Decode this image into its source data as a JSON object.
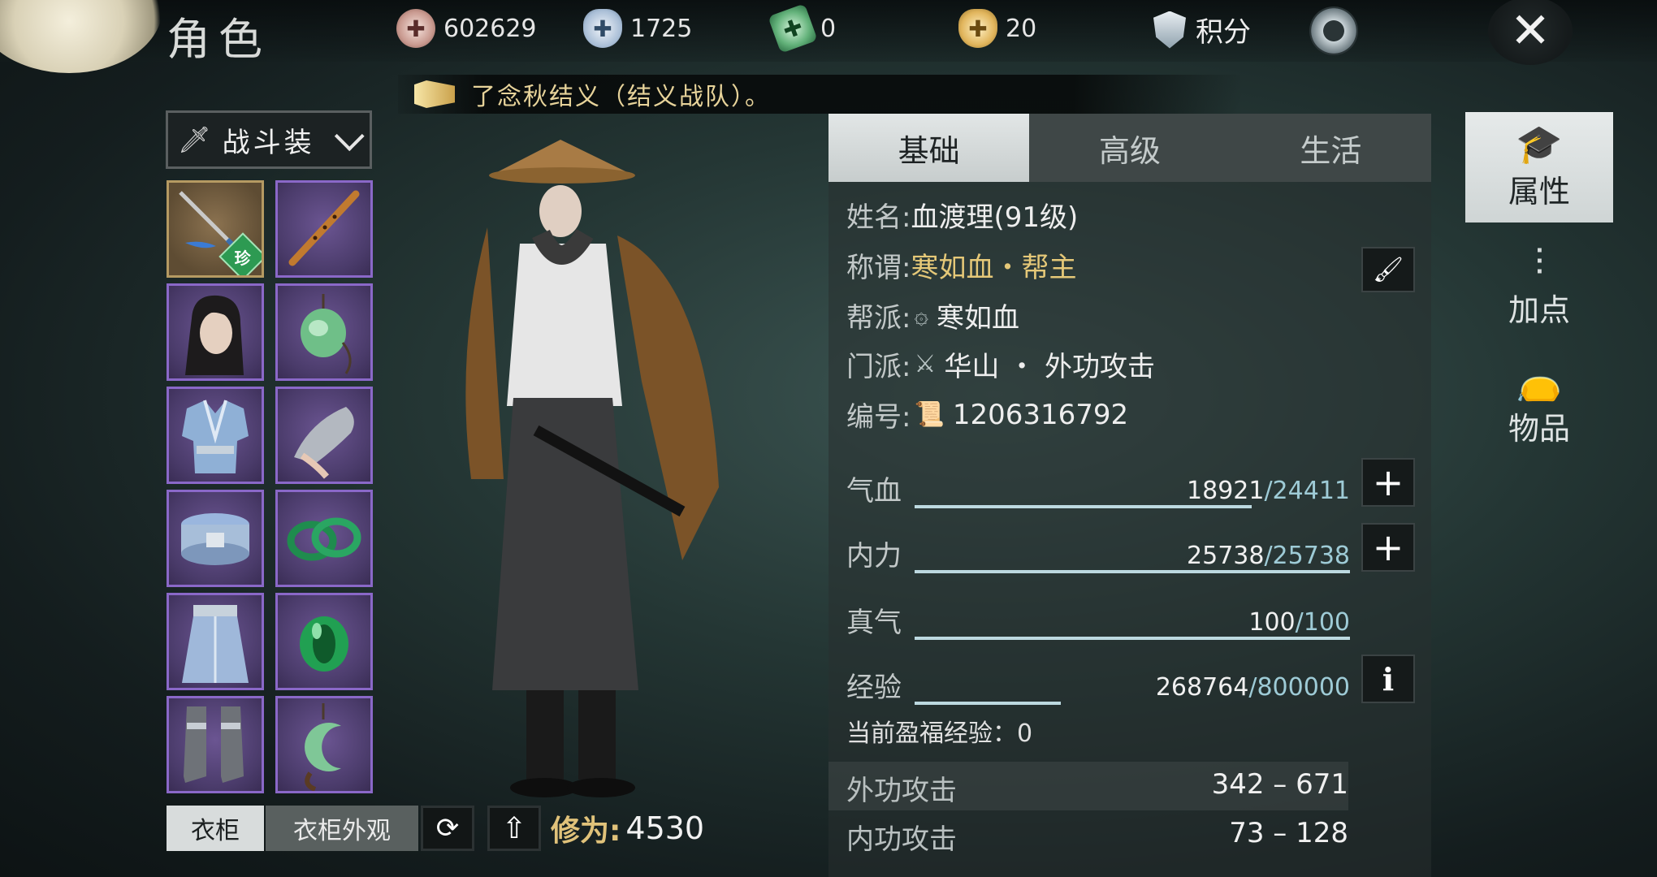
{
  "header": {
    "title": "角色",
    "resources": [
      {
        "icon": "silver-coin-icon",
        "value": "602629"
      },
      {
        "icon": "ingot-icon",
        "value": "1725"
      },
      {
        "icon": "jade-ticket-icon",
        "value": "0"
      },
      {
        "icon": "gold-ingot-icon",
        "value": "20"
      }
    ],
    "score_label": "积分",
    "close_symbol": "✕"
  },
  "notice": "了念秋结义（结义战队）。",
  "outfit": {
    "selected": "战斗装"
  },
  "equipment": {
    "slots": [
      {
        "name": "weapon-slot",
        "icon": "spear-icon",
        "rarity": "珍"
      },
      {
        "name": "flute-slot",
        "icon": "flute-icon"
      },
      {
        "name": "head-slot",
        "icon": "hair-icon"
      },
      {
        "name": "pendant-slot",
        "icon": "jade-pendant-icon"
      },
      {
        "name": "chest-slot",
        "icon": "armor-icon"
      },
      {
        "name": "glove-slot",
        "icon": "glove-icon"
      },
      {
        "name": "belt-slot",
        "icon": "belt-icon"
      },
      {
        "name": "bracelet-slot",
        "icon": "bracelet-icon"
      },
      {
        "name": "pants-slot",
        "icon": "pants-icon"
      },
      {
        "name": "ring-slot",
        "icon": "ring-icon"
      },
      {
        "name": "boots-slot",
        "icon": "boots-icon"
      },
      {
        "name": "amulet-slot",
        "icon": "amulet-icon"
      }
    ]
  },
  "bottom": {
    "wardrobe": "衣柜",
    "wardrobe_appearance": "衣柜外观",
    "cultivation_label": "修为:",
    "cultivation_value": "4530"
  },
  "tabs": [
    {
      "label": "基础",
      "active": true
    },
    {
      "label": "高级",
      "active": false
    },
    {
      "label": "生活",
      "active": false
    }
  ],
  "profile": {
    "name_key": "姓名:",
    "name_value": "血渡理(91级)",
    "title_key": "称谓:",
    "title_value": "寒如血・帮主",
    "guild_key": "帮派:",
    "guild_value": "寒如血",
    "school_key": "门派:",
    "school_value": "华山 ・ 外功攻击",
    "id_key": "编号:",
    "id_value": "1206316792"
  },
  "stats": [
    {
      "key": "气血",
      "current": "18921",
      "max": "/24411",
      "fraction": 0.775,
      "button": "+"
    },
    {
      "key": "内力",
      "current": "25738",
      "max": "/25738",
      "fraction": 1.0,
      "button": "+"
    },
    {
      "key": "真气",
      "current": "100",
      "max": "/100",
      "fraction": 1.0
    },
    {
      "key": "经验",
      "current": "268764",
      "max": "/800000",
      "fraction": 0.336,
      "button": "i"
    }
  ],
  "bonus_exp": "当前盈福经验：0",
  "attacks": [
    {
      "key": "外功攻击",
      "value": "342 – 671"
    },
    {
      "key": "内功攻击",
      "value": "73 – 128"
    }
  ],
  "side_nav": [
    {
      "label": "属性",
      "icon": "scholar-icon",
      "active": true
    },
    {
      "label": "加点",
      "icon": "sliders-icon",
      "active": false
    },
    {
      "label": "物品",
      "icon": "bag-icon",
      "active": false
    }
  ],
  "colors": {
    "gold": "#e5c878",
    "accent_blue": "#9ecbd6",
    "rare_green": "#2d9a52"
  }
}
